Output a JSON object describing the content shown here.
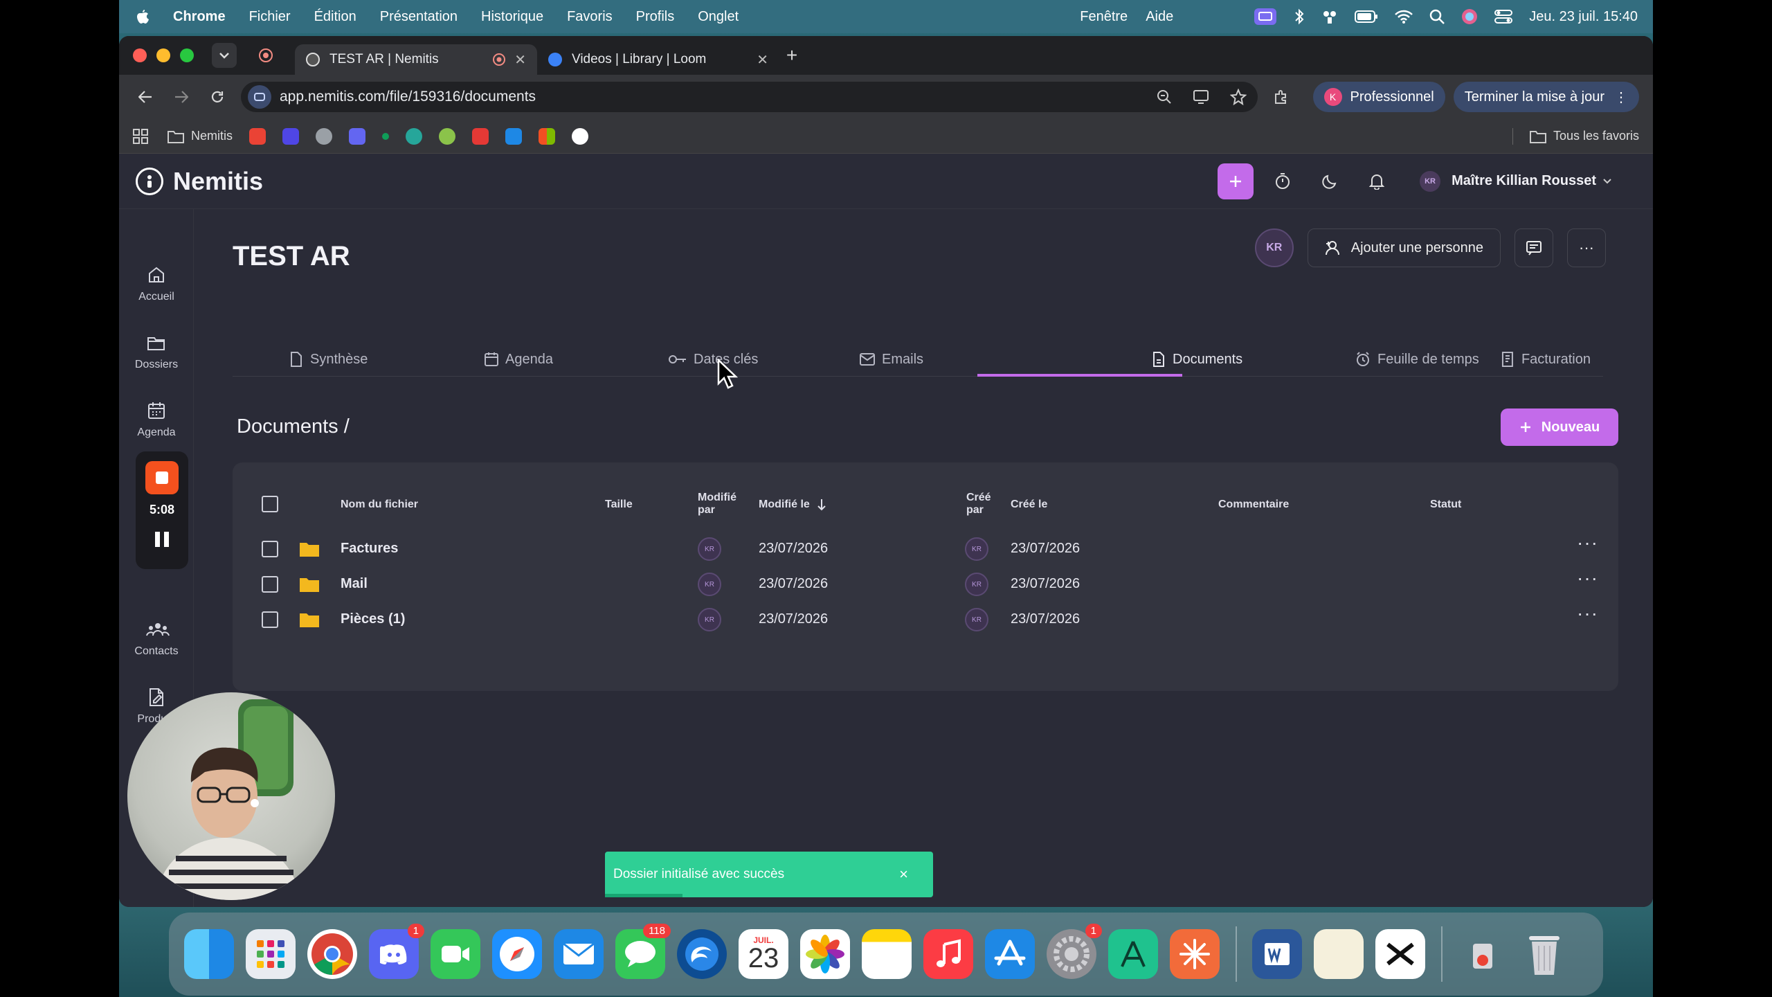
{
  "menubar": {
    "apple": "",
    "app": "Chrome",
    "menus": [
      "Fichier",
      "Édition",
      "Présentation",
      "Historique",
      "Favoris",
      "Profils",
      "Onglet"
    ],
    "right_menus": [
      "Fenêtre",
      "Aide"
    ],
    "clock": "Jeu. 23 juil.  15:40"
  },
  "browser": {
    "tabs": [
      {
        "title": "TEST AR | Nemitis"
      },
      {
        "title": "Videos | Library | Loom"
      }
    ],
    "url": "app.nemitis.com/file/159316/documents",
    "profile_label": "Professionnel",
    "update_label": "Terminer la mise à jour",
    "bookmarks": {
      "folder": "Nemitis",
      "all": "Tous les favoris"
    }
  },
  "app": {
    "name": "Nemitis",
    "user": "Maître Killian Rousset",
    "user_initials": "KR",
    "sidebar": [
      {
        "label": "Accueil",
        "icon": "home-icon"
      },
      {
        "label": "Dossiers",
        "icon": "folder-open-icon"
      },
      {
        "label": "Agenda",
        "icon": "calendar-icon"
      },
      {
        "label": "Contacts",
        "icon": "contacts-icon"
      },
      {
        "label": "Product",
        "icon": "document-edit-icon"
      }
    ],
    "recorder": {
      "time": "5:08"
    },
    "case": {
      "title": "TEST AR",
      "member_initials": "KR",
      "add_person": "Ajouter une personne"
    },
    "tabs": [
      {
        "label": "Synthèse"
      },
      {
        "label": "Agenda"
      },
      {
        "label": "Dates clés"
      },
      {
        "label": "Emails"
      },
      {
        "label": "Documents"
      },
      {
        "label": "Feuille de temps"
      },
      {
        "label": "Facturation"
      }
    ],
    "breadcrumb": "Documents  /",
    "new_button": "Nouveau",
    "table": {
      "headers": {
        "name": "Nom du fichier",
        "size": "Taille",
        "modified_by_1": "Modifié",
        "modified_by_2": "par",
        "modified_on": "Modifié le",
        "created_by_1": "Créé",
        "created_by_2": "par",
        "created_on": "Créé le",
        "comment": "Commentaire",
        "status": "Statut"
      },
      "rows": [
        {
          "name": "Factures",
          "mod_by": "KR",
          "mod_on": "23/07/2026",
          "cre_by": "KR",
          "cre_on": "23/07/2026"
        },
        {
          "name": "Mail",
          "mod_by": "KR",
          "mod_on": "23/07/2026",
          "cre_by": "KR",
          "cre_on": "23/07/2026"
        },
        {
          "name": "Pièces (1)",
          "mod_by": "KR",
          "mod_on": "23/07/2026",
          "cre_by": "KR",
          "cre_on": "23/07/2026"
        }
      ]
    },
    "toast": {
      "message": "Dossier initialisé avec succès",
      "close": "×"
    }
  },
  "dock": {
    "calendar_day": "23",
    "calendar_month": "JUIL.",
    "badges": {
      "discord": "1",
      "messages": "118",
      "settings": "1"
    }
  },
  "colors": {
    "accent": "#c36bea",
    "app_bg": "#2a2b37",
    "card_bg": "#33343f",
    "toast": "#2fcf95",
    "folder": "#f3b81e"
  }
}
